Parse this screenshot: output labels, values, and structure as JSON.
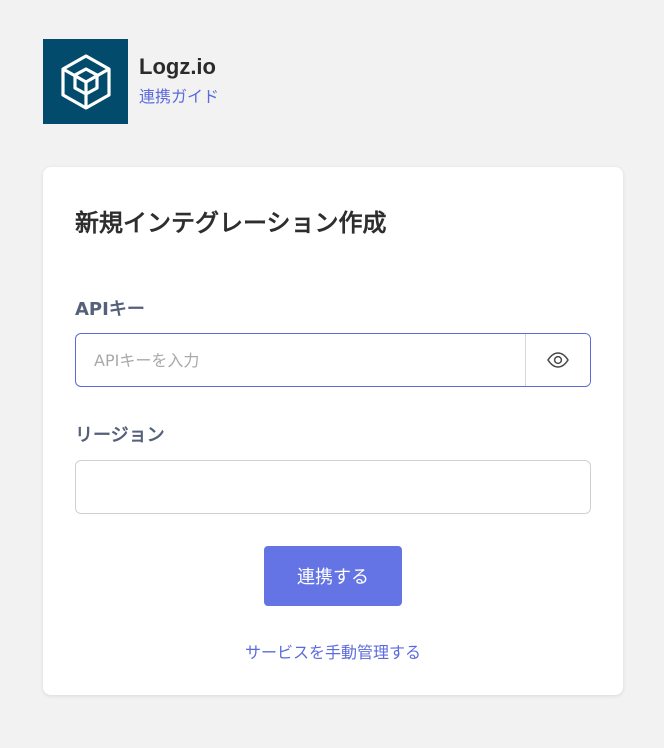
{
  "header": {
    "app_name": "Logz.io",
    "guide_link": "連携ガイド"
  },
  "card": {
    "title": "新規インテグレーション作成",
    "api_key": {
      "label": "APIキー",
      "value": "",
      "placeholder": "APIキーを入力",
      "toggle_icon": "eye-icon"
    },
    "region": {
      "label": "リージョン",
      "value": ""
    },
    "connect_button": "連携する",
    "manual_link": "サービスを手動管理する"
  },
  "colors": {
    "logo_bg": "#024b6c",
    "accent": "#5b6bdc",
    "button": "#6474e5"
  }
}
